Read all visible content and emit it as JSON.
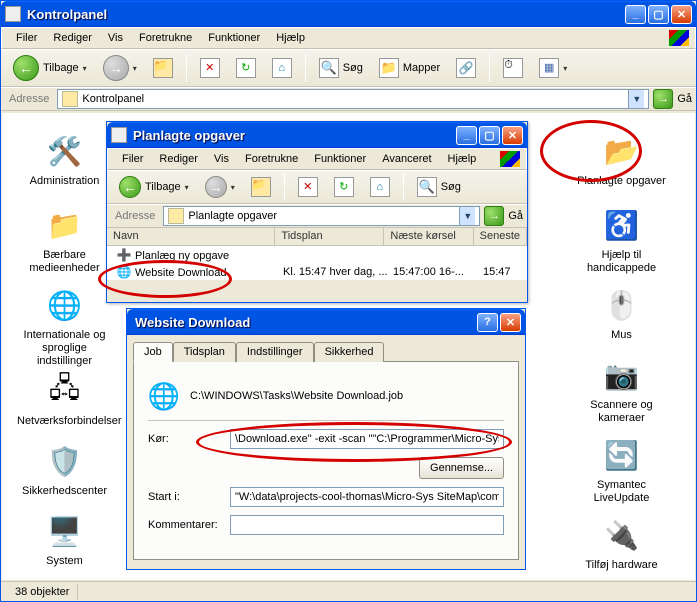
{
  "mainWindow": {
    "title": "Kontrolpanel",
    "menu": [
      "Filer",
      "Rediger",
      "Vis",
      "Foretrukne",
      "Funktioner",
      "Hjælp"
    ],
    "toolbar": {
      "back": "Tilbage",
      "search": "Søg",
      "folders": "Mapper"
    },
    "addressLabel": "Adresse",
    "addressValue": "Kontrolpanel",
    "go": "Gå",
    "status": "38 objekter",
    "icons": {
      "left": [
        {
          "label": "Administration",
          "glyph": "🛠️"
        },
        {
          "label": "Bærbare medieenheder",
          "glyph": "📁"
        },
        {
          "label": "Internationale og sproglige indstillinger",
          "glyph": "🌐"
        },
        {
          "label": "Netværksforbindelser",
          "glyph": "🖧"
        },
        {
          "label": "Sikkerhedscenter",
          "glyph": "🛡️"
        },
        {
          "label": "System",
          "glyph": "🖥️"
        }
      ],
      "right": [
        {
          "label": "Planlagte opgaver",
          "glyph": "📂"
        },
        {
          "label": "Hjælp til handicappede",
          "glyph": "♿"
        },
        {
          "label": "Mus",
          "glyph": "🖱️"
        },
        {
          "label": "Scannere og kameraer",
          "glyph": "📷"
        },
        {
          "label": "Symantec LiveUpdate",
          "glyph": "🔄"
        },
        {
          "label": "Tilføj hardware",
          "glyph": "🔌"
        }
      ]
    }
  },
  "tasksWindow": {
    "title": "Planlagte opgaver",
    "menu": [
      "Filer",
      "Rediger",
      "Vis",
      "Foretrukne",
      "Funktioner",
      "Avanceret",
      "Hjælp"
    ],
    "toolbar": {
      "back": "Tilbage",
      "search": "Søg"
    },
    "addressLabel": "Adresse",
    "addressValue": "Planlagte opgaver",
    "go": "Gå",
    "columns": [
      "Navn",
      "Tidsplan",
      "Næste kørsel",
      "Seneste"
    ],
    "rows": [
      {
        "icon": "➕",
        "name": "Planlæg ny opgave",
        "tidsplan": "",
        "naeste": "",
        "sen": ""
      },
      {
        "icon": "🌐",
        "name": "Website Download",
        "tidsplan": "Kl. 15:47 hver dag, ...",
        "naeste": "15:47:00  16-...",
        "sen": "15:47"
      }
    ]
  },
  "dialog": {
    "title": "Website Download",
    "tabs": [
      "Job",
      "Tidsplan",
      "Indstillinger",
      "Sikkerhed"
    ],
    "activeTab": "Job",
    "jobPath": "C:\\WINDOWS\\Tasks\\Website Download.job",
    "fields": {
      "korLabel": "Kør:",
      "korValue": "\\Download.exe\" -exit -scan \"\"C:\\Programmer\\Micro-Sys Si",
      "browse": "Gennemse...",
      "startLabel": "Start i:",
      "startValue": "\"W:\\data\\projects-cool-thomas\\Micro-Sys SiteMap\\compil",
      "commentLabel": "Kommentarer:"
    }
  }
}
